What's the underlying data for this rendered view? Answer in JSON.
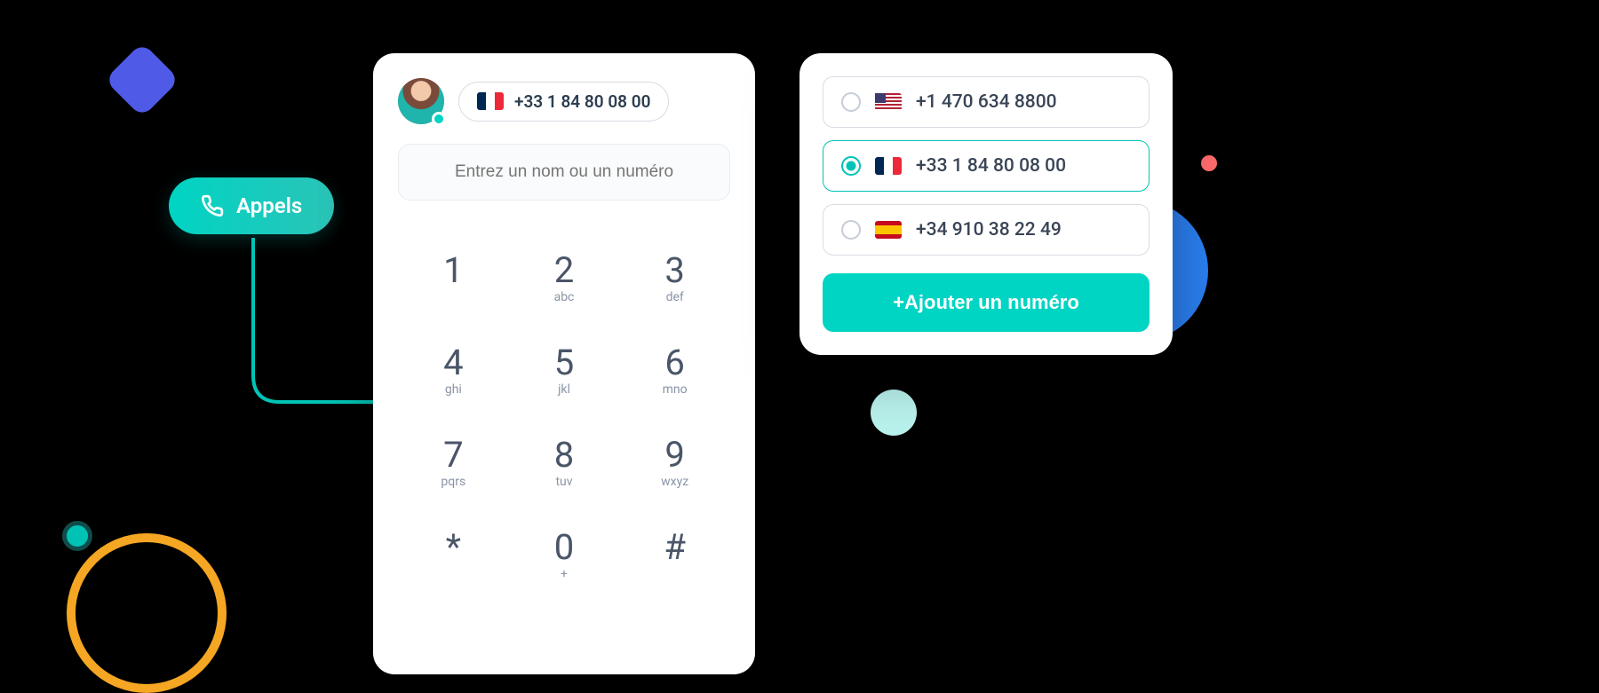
{
  "appels": {
    "label": "Appels"
  },
  "dialer": {
    "current_number": "+33 1 84 80 08 00",
    "current_flag": "fr",
    "placeholder": "Entrez un nom ou un numéro",
    "keys": [
      {
        "digit": "1",
        "letters": ""
      },
      {
        "digit": "2",
        "letters": "abc"
      },
      {
        "digit": "3",
        "letters": "def"
      },
      {
        "digit": "4",
        "letters": "ghi"
      },
      {
        "digit": "5",
        "letters": "jkl"
      },
      {
        "digit": "6",
        "letters": "mno"
      },
      {
        "digit": "7",
        "letters": "pqrs"
      },
      {
        "digit": "8",
        "letters": "tuv"
      },
      {
        "digit": "9",
        "letters": "wxyz"
      },
      {
        "digit": "*",
        "letters": ""
      },
      {
        "digit": "0",
        "letters": "+"
      },
      {
        "digit": "#",
        "letters": ""
      }
    ]
  },
  "numbers_panel": {
    "items": [
      {
        "flag": "us",
        "number": "+1 470 634 8800",
        "selected": false
      },
      {
        "flag": "fr",
        "number": "+33 1 84 80 08 00",
        "selected": true
      },
      {
        "flag": "es",
        "number": "+34 910 38 22 49",
        "selected": false
      }
    ],
    "add_label": "+Ajouter un numéro"
  },
  "colors": {
    "accent": "#00d4c3",
    "blue": "#2a7ff0",
    "indigo": "#4f5be6",
    "yellow": "#f5a623",
    "coral": "#ff6b6b"
  }
}
